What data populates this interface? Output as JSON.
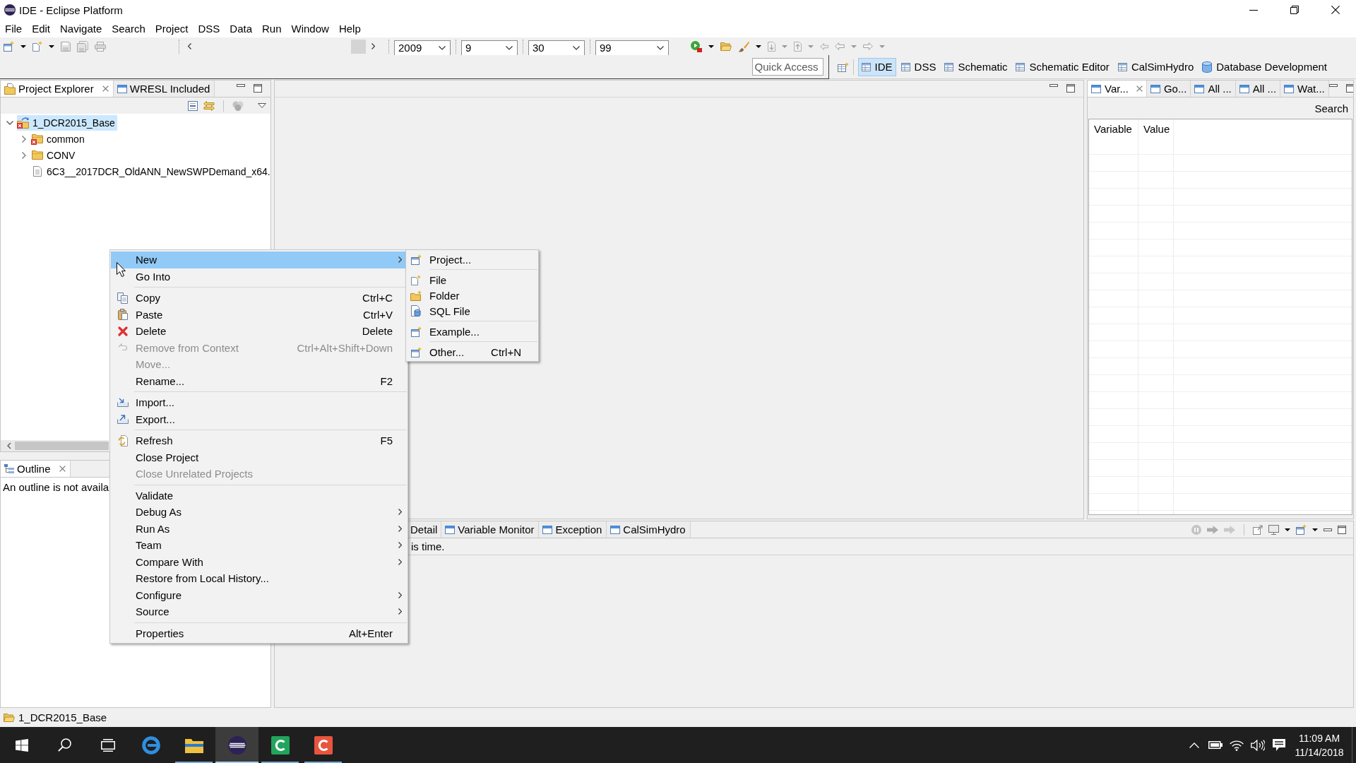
{
  "window": {
    "title": "IDE - Eclipse Platform"
  },
  "menu_bar": [
    "File",
    "Edit",
    "Navigate",
    "Search",
    "Project",
    "DSS",
    "Data",
    "Run",
    "Window",
    "Help"
  ],
  "toolbar": {
    "combos": [
      "2009",
      "9",
      "30",
      "99"
    ]
  },
  "perspective_bar": {
    "quick_access": {
      "placeholder": "Quick Access"
    },
    "perspectives": [
      {
        "label": "IDE",
        "selected": true
      },
      {
        "label": "DSS",
        "selected": false
      },
      {
        "label": "Schematic",
        "selected": false
      },
      {
        "label": "Schematic Editor",
        "selected": false
      },
      {
        "label": "CalSimHydro",
        "selected": false
      },
      {
        "label": "Database Development",
        "selected": false
      }
    ]
  },
  "project_explorer": {
    "tabs": [
      {
        "label": "Project Explorer",
        "selected": true
      },
      {
        "label": "WRESL Included",
        "selected": false
      }
    ],
    "tree": [
      {
        "kind": "project",
        "label": "1_DCR2015_Base",
        "expanded": true,
        "selected": true,
        "error": true,
        "children": [
          {
            "kind": "folder",
            "label": "common",
            "expanded": false,
            "selected": false,
            "error": true
          },
          {
            "kind": "folder",
            "label": "CONV",
            "expanded": false,
            "selected": false,
            "error": false
          },
          {
            "kind": "file",
            "label": "6C3__2017DCR_OldANN_NewSWPDemand_x64.",
            "selected": false,
            "error": false
          }
        ]
      }
    ]
  },
  "outline": {
    "tabs": [
      {
        "label": "Outline",
        "selected": true
      }
    ],
    "message": "An outline is not availa"
  },
  "variables_panel": {
    "tabs": [
      {
        "label": "Var...",
        "selected": true
      },
      {
        "label": "Go...",
        "selected": false
      },
      {
        "label": "All ...",
        "selected": false
      },
      {
        "label": "All ...",
        "selected": false
      },
      {
        "label": "Wat...",
        "selected": false
      }
    ],
    "search": "Search",
    "table": {
      "columns": [
        "Variable",
        "Value"
      ]
    }
  },
  "bottom_panel": {
    "tabs": [
      {
        "label": "Detail",
        "selected": false
      },
      {
        "label": "Variable Monitor",
        "selected": false
      },
      {
        "label": "Exception",
        "selected": false
      },
      {
        "label": "CalSimHydro",
        "selected": false
      }
    ],
    "message": "is time."
  },
  "status_bar": {
    "text": "1_DCR2015_Base"
  },
  "context_menu": {
    "items": [
      {
        "kind": "item",
        "label": "New",
        "submenu": true,
        "disabled": false,
        "selected": true
      },
      {
        "kind": "item",
        "label": "Go Into",
        "submenu": false,
        "disabled": false,
        "selected": false
      },
      {
        "kind": "separator"
      },
      {
        "kind": "item",
        "label": "Copy",
        "shortcut": "Ctrl+C",
        "submenu": false,
        "disabled": false,
        "selected": false
      },
      {
        "kind": "item",
        "label": "Paste",
        "shortcut": "Ctrl+V",
        "submenu": false,
        "disabled": false,
        "selected": false
      },
      {
        "kind": "item",
        "label": "Delete",
        "shortcut": "Delete",
        "submenu": false,
        "disabled": false,
        "selected": false
      },
      {
        "kind": "item",
        "label": "Remove from Context",
        "shortcut": "Ctrl+Alt+Shift+Down",
        "submenu": false,
        "disabled": true,
        "selected": false
      },
      {
        "kind": "item",
        "label": "Move...",
        "submenu": false,
        "disabled": true,
        "selected": false
      },
      {
        "kind": "item",
        "label": "Rename...",
        "shortcut": "F2",
        "submenu": false,
        "disabled": false,
        "selected": false
      },
      {
        "kind": "separator"
      },
      {
        "kind": "item",
        "label": "Import...",
        "submenu": false,
        "disabled": false,
        "selected": false
      },
      {
        "kind": "item",
        "label": "Export...",
        "submenu": false,
        "disabled": false,
        "selected": false
      },
      {
        "kind": "separator"
      },
      {
        "kind": "item",
        "label": "Refresh",
        "shortcut": "F5",
        "submenu": false,
        "disabled": false,
        "selected": false
      },
      {
        "kind": "item",
        "label": "Close Project",
        "submenu": false,
        "disabled": false,
        "selected": false
      },
      {
        "kind": "item",
        "label": "Close Unrelated Projects",
        "submenu": false,
        "disabled": true,
        "selected": false
      },
      {
        "kind": "separator"
      },
      {
        "kind": "item",
        "label": "Validate",
        "submenu": false,
        "disabled": false,
        "selected": false
      },
      {
        "kind": "item",
        "label": "Debug As",
        "submenu": true,
        "disabled": false,
        "selected": false
      },
      {
        "kind": "item",
        "label": "Run As",
        "submenu": true,
        "disabled": false,
        "selected": false
      },
      {
        "kind": "item",
        "label": "Team",
        "submenu": true,
        "disabled": false,
        "selected": false
      },
      {
        "kind": "item",
        "label": "Compare With",
        "submenu": true,
        "disabled": false,
        "selected": false
      },
      {
        "kind": "item",
        "label": "Restore from Local History...",
        "submenu": false,
        "disabled": false,
        "selected": false
      },
      {
        "kind": "item",
        "label": "Configure",
        "submenu": true,
        "disabled": false,
        "selected": false
      },
      {
        "kind": "item",
        "label": "Source",
        "submenu": true,
        "disabled": false,
        "selected": false
      },
      {
        "kind": "separator"
      },
      {
        "kind": "item",
        "label": "Properties",
        "shortcut": "Alt+Enter",
        "submenu": false,
        "disabled": false,
        "selected": false
      }
    ],
    "submenu": {
      "items": [
        {
          "kind": "item",
          "label": "Project..."
        },
        {
          "kind": "separator"
        },
        {
          "kind": "item",
          "label": "File"
        },
        {
          "kind": "item",
          "label": "Folder"
        },
        {
          "kind": "item",
          "label": "SQL File"
        },
        {
          "kind": "separator"
        },
        {
          "kind": "item",
          "label": "Example..."
        },
        {
          "kind": "separator"
        },
        {
          "kind": "item",
          "label": "Other...",
          "shortcut": "Ctrl+N"
        }
      ]
    }
  },
  "taskbar": {
    "apps": [
      {
        "running": false,
        "selected": false
      },
      {
        "running": true,
        "selected": false
      },
      {
        "running": true,
        "selected": true
      },
      {
        "running": true,
        "selected": false
      },
      {
        "running": true,
        "selected": false
      }
    ],
    "clock": {
      "time": "11:09 AM",
      "date": "11/14/2018"
    }
  }
}
